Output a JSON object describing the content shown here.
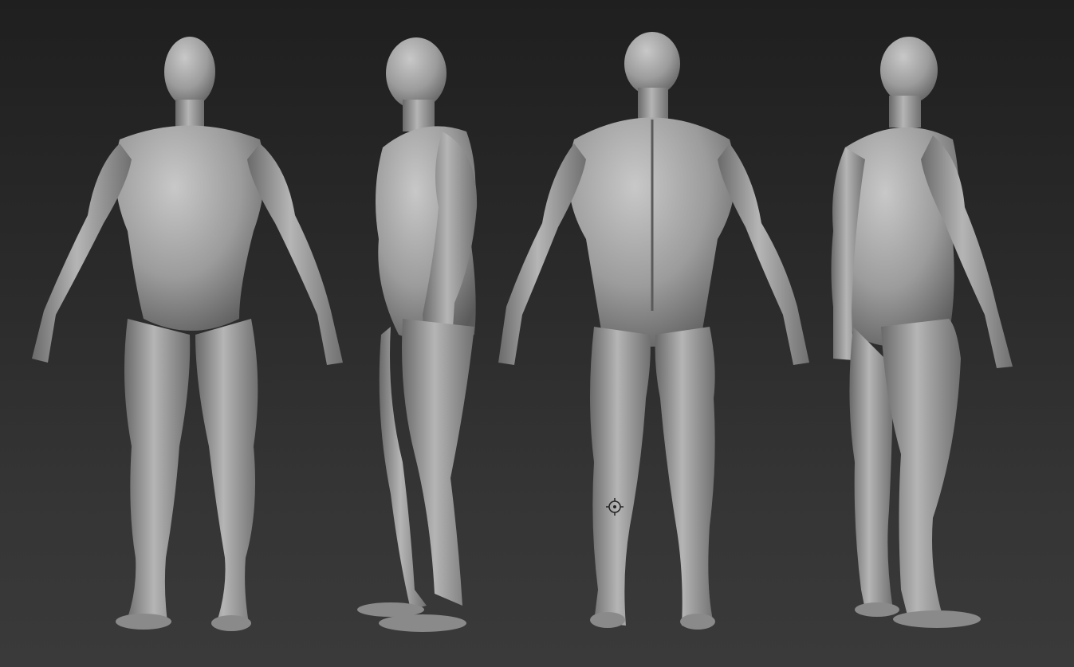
{
  "viewport": {
    "background_top": "#1f1f1f",
    "background_bottom": "#3a3a3a",
    "model_color": "#9a9a9a",
    "model_shadow": "#5c5c5c",
    "model_highlight": "#c4c4c4"
  },
  "views": [
    {
      "id": "front",
      "label": ""
    },
    {
      "id": "side-left",
      "label": ""
    },
    {
      "id": "back",
      "label": ""
    },
    {
      "id": "three-quarter-back",
      "label": ""
    }
  ],
  "gizmo": {
    "icon": "transpose-target-icon"
  }
}
